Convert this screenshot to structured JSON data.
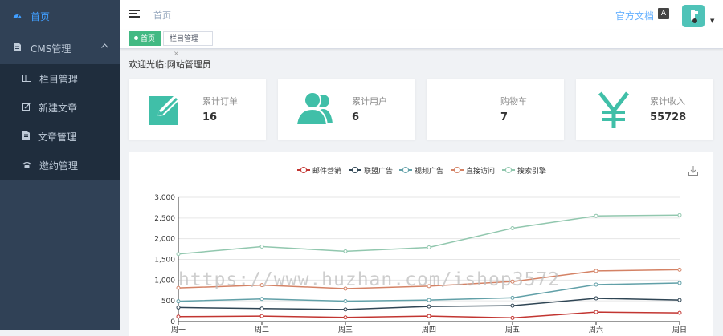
{
  "sidebar": {
    "home_label": "首页",
    "cms_label": "CMS管理",
    "items": [
      {
        "label": "栏目管理",
        "icon": "column-icon"
      },
      {
        "label": "新建文章",
        "icon": "edit-icon"
      },
      {
        "label": "文章管理",
        "icon": "document-icon"
      },
      {
        "label": "邀约管理",
        "icon": "phone-icon"
      }
    ]
  },
  "navbar": {
    "breadcrumb": "首页",
    "docs_label": "官方文档",
    "lang_glyph": "A",
    "avatar_caret": "▼"
  },
  "tags": {
    "active_label": "首页",
    "second_label": "栏目管理",
    "close_glyph": "×"
  },
  "welcome": "欢迎光临:网站管理员",
  "cards": [
    {
      "label": "累计订单",
      "value": "16",
      "icon": "edit-icon"
    },
    {
      "label": "累计用户",
      "value": "6",
      "icon": "users-icon"
    },
    {
      "label": "购物车",
      "value": "7",
      "icon": "cart-icon"
    },
    {
      "label": "累计收入",
      "value": "55728",
      "icon": "yen-icon"
    }
  ],
  "colors": {
    "accent": "#40bfa8",
    "sidebar": "#304156",
    "tag_active": "#42b983"
  },
  "chart_data": {
    "type": "line",
    "categories": [
      "周一",
      "周二",
      "周三",
      "周四",
      "周五",
      "周六",
      "周日"
    ],
    "ylim": [
      0,
      3000
    ],
    "yticks": [
      "0",
      "500",
      "1,000",
      "1,500",
      "2,000",
      "2,500",
      "3,000"
    ],
    "legend_position": "top-center",
    "grid": true,
    "series": [
      {
        "name": "邮件营销",
        "color": "#c23531",
        "values": [
          120,
          132,
          101,
          134,
          90,
          230,
          210
        ]
      },
      {
        "name": "联盟广告",
        "color": "#2f4554",
        "values": [
          340,
          314,
          292,
          366,
          384,
          561,
          520
        ]
      },
      {
        "name": "视频广告",
        "color": "#61a0a8",
        "values": [
          490,
          546,
          493,
          520,
          574,
          891,
          930
        ]
      },
      {
        "name": "直接访问",
        "color": "#d48265",
        "values": [
          810,
          878,
          794,
          854,
          964,
          1221,
          1250
        ]
      },
      {
        "name": "搜索引擎",
        "color": "#91c7ae",
        "values": [
          1630,
          1810,
          1695,
          1790,
          2254,
          2551,
          2570
        ]
      }
    ]
  },
  "watermark": "https://www.huzhan.com/ishop3572"
}
